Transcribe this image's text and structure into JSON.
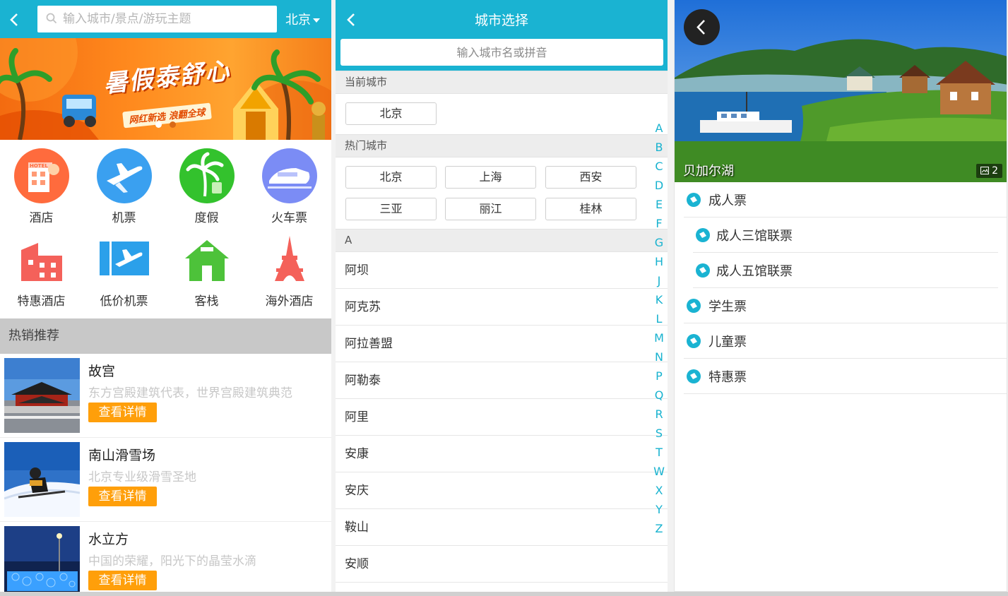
{
  "home": {
    "search_placeholder": "输入城市/景点/游玩主题",
    "city": "北京",
    "categories": [
      {
        "label": "酒店",
        "icon": "hotel-icon",
        "color": "#ff6b3d"
      },
      {
        "label": "机票",
        "icon": "plane-icon",
        "color": "#3aa0f0"
      },
      {
        "label": "度假",
        "icon": "palm-icon",
        "color": "#33c22d"
      },
      {
        "label": "火车票",
        "icon": "train-icon",
        "color": "#7b8cf5"
      },
      {
        "label": "特惠酒店",
        "icon": "building-icon",
        "color": "#f4615a"
      },
      {
        "label": "低价机票",
        "icon": "ticket-plane-icon",
        "color": "#2ba0ea"
      },
      {
        "label": "客栈",
        "icon": "house-icon",
        "color": "#4dc23a"
      },
      {
        "label": "海外酒店",
        "icon": "tower-icon",
        "color": "#f4615a"
      }
    ],
    "hot_title": "热销推荐",
    "recommendations": [
      {
        "name": "故宫",
        "desc": "东方宫殿建筑代表，世界宫殿建筑典范",
        "button": "查看详情"
      },
      {
        "name": "南山滑雪场",
        "desc": "北京专业级滑雪圣地",
        "button": "查看详情"
      },
      {
        "name": "水立方",
        "desc": "中国的荣耀，阳光下的晶莹水滴",
        "button": "查看详情"
      }
    ]
  },
  "city_select": {
    "title": "城市选择",
    "search_placeholder": "输入城市名或拼音",
    "current_label": "当前城市",
    "current_city": "北京",
    "hot_label": "热门城市",
    "hot_cities": [
      "北京",
      "上海",
      "西安",
      "三亚",
      "丽江",
      "桂林"
    ],
    "section_letter": "A",
    "cities": [
      "阿坝",
      "阿克苏",
      "阿拉善盟",
      "阿勒泰",
      "阿里",
      "安康",
      "安庆",
      "鞍山",
      "安顺"
    ],
    "alphabet": [
      "A",
      "B",
      "C",
      "D",
      "E",
      "F",
      "G",
      "H",
      "J",
      "K",
      "L",
      "M",
      "N",
      "P",
      "Q",
      "R",
      "S",
      "T",
      "W",
      "X",
      "Y",
      "Z"
    ]
  },
  "detail": {
    "title": "贝加尔湖",
    "image_count": "2",
    "tickets": [
      {
        "label": "成人票",
        "level": 0
      },
      {
        "label": "成人三馆联票",
        "level": 1
      },
      {
        "label": "成人五馆联票",
        "level": 1
      },
      {
        "label": "学生票",
        "level": 0
      },
      {
        "label": "儿童票",
        "level": 0
      },
      {
        "label": "特惠票",
        "level": 0
      }
    ]
  },
  "colors": {
    "primary": "#1ab3d2",
    "button_orange": "#ff9f0a"
  }
}
